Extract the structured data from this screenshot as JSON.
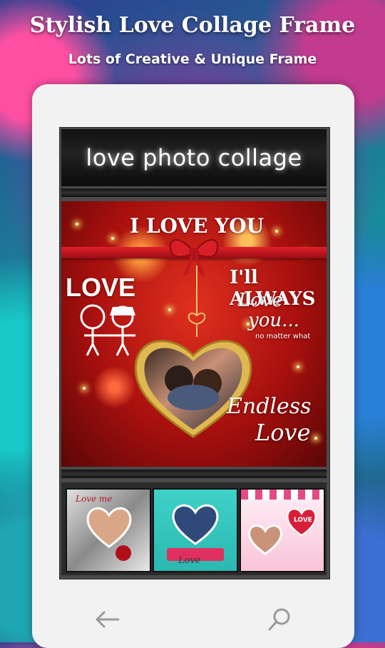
{
  "header": {
    "title": "Stylish Love Collage Frame",
    "subtitle": "Lots of Creative & Unique Frame"
  },
  "app": {
    "title": "love photo collage"
  },
  "main_frame": {
    "title_text": "I LOVE YOU",
    "love_text": "LOVE",
    "always_text": "I'll ALWAYS",
    "love_script": "Love",
    "you_text": "you...",
    "no_matter": "no matter what",
    "endless": "Endless",
    "endless_love": "Love"
  },
  "thumbnails": [
    {
      "caption": "Love me"
    },
    {
      "caption": "Love"
    },
    {
      "caption": "LOVE"
    }
  ],
  "nav": {
    "back_icon": "arrow-left-icon",
    "search_icon": "search-icon"
  },
  "colors": {
    "frame_red": "#c0181a",
    "gold": "#d8b24a",
    "dark_bar": "#111111"
  }
}
